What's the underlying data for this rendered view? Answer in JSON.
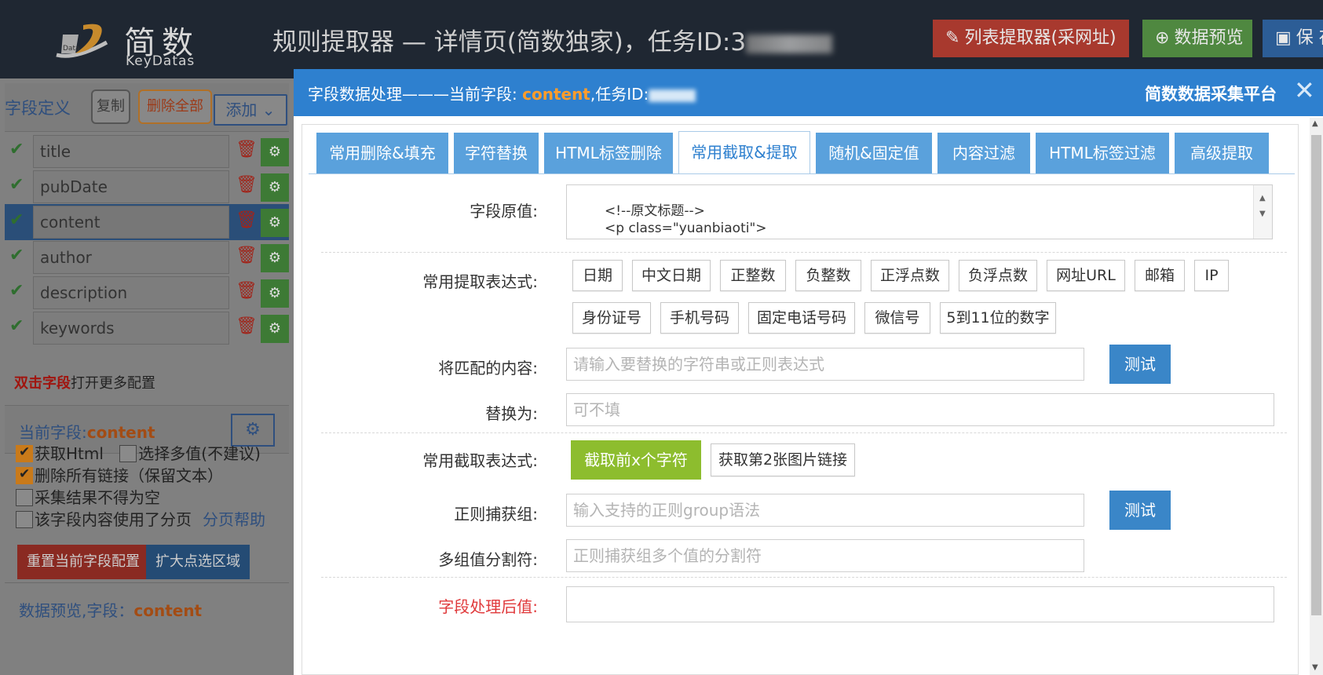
{
  "header": {
    "logo_cn": "简数",
    "logo_en": "KeyDatas",
    "title": "规则提取器 — 详情页(简数独家)，任务ID:3",
    "list_extractor_label": "列表提取器(采网址)",
    "data_preview_label": "数据预览",
    "save_label": "保 存"
  },
  "sidebar": {
    "title": "字段定义",
    "copy_label": "复制",
    "delete_all_label": "删除全部",
    "add_label": "添加",
    "fields": [
      {
        "name": "title"
      },
      {
        "name": "pubDate"
      },
      {
        "name": "content"
      },
      {
        "name": "author"
      },
      {
        "name": "description"
      },
      {
        "name": "keywords"
      }
    ],
    "hint_bold": "双击字段",
    "hint_rest": "打开更多配置",
    "current_field_label": "当前字段:",
    "current_field_value": "content",
    "options": [
      {
        "label": "获取Html",
        "checked": true
      },
      {
        "label": "选择多值(不建议)",
        "checked": false
      },
      {
        "label": "删除所有链接（保留文本）",
        "checked": true
      },
      {
        "label": "采集结果不得为空",
        "checked": false
      },
      {
        "label": "该字段内容使用了分页",
        "checked": false
      }
    ],
    "pagination_help": "分页帮助",
    "reset_label": "重置当前字段配置",
    "expand_label": "扩大点选区域",
    "preview_label": "数据预览,字段：",
    "preview_field": "content"
  },
  "modal": {
    "title_prefix": "字段数据处理———当前字段: ",
    "title_field": "content",
    "title_suffix": ",任务ID:",
    "brand": "简数数据采集平台",
    "tabs": [
      "常用删除&填充",
      "字符替换",
      "HTML标签删除",
      "常用截取&提取",
      "随机&固定值",
      "内容过滤",
      "HTML标签过滤",
      "高级提取"
    ],
    "active_tab": "常用截取&提取",
    "raw_value_label": "字段原值:",
    "raw_value_lines": [
      "<!--原文标题-->",
      "<p class=\"yuanbiaoti\">"
    ],
    "extract_label": "常用提取表达式:",
    "extract_chips": [
      "日期",
      "中文日期",
      "正整数",
      "负整数",
      "正浮点数",
      "负浮点数",
      "网址URL",
      "邮箱",
      "IP",
      "身份证号",
      "手机号码",
      "固定电话号码",
      "微信号",
      "5到11位的数字"
    ],
    "match_label": "将匹配的内容:",
    "match_placeholder": "请输入要替换的字符串或正则表达式",
    "test_label": "测试",
    "replace_label": "替换为:",
    "replace_placeholder": "可不填",
    "cut_label": "常用截取表达式:",
    "cut_first_label": "截取前x个字符",
    "cut_second_image_label": "获取第2张图片链接",
    "group_label": "正则捕获组:",
    "group_placeholder": "输入支持的正则group语法",
    "separator_label": "多组值分割符:",
    "separator_placeholder": "正则捕获组多个值的分割符",
    "result_label": "字段处理后值:"
  },
  "colors": {
    "header_bg": "#1f2732",
    "modal_head": "#2e80cf",
    "tab_bg": "#5aa1dc",
    "accent_orange": "#ff9c2a",
    "green": "#8dbd2e",
    "test_blue": "#3a86c8",
    "red_label": "#e0393b"
  }
}
